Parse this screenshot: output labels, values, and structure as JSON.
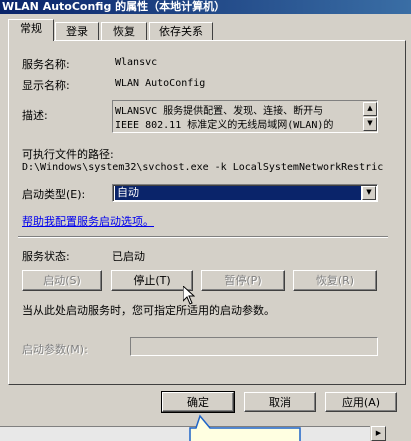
{
  "window": {
    "title": "WLAN AutoConfig 的属性（本地计算机）"
  },
  "tabs": [
    "常规",
    "登录",
    "恢复",
    "依存关系"
  ],
  "general": {
    "service_name_label": "服务名称:",
    "service_name_value": "Wlansvc",
    "display_name_label": "显示名称:",
    "display_name_value": "WLAN AutoConfig",
    "description_label": "描述:",
    "description_line1": "WLANSVC 服务提供配置、发现、连接、断开与",
    "description_line2": "IEEE 802.11 标准定义的无线局域网(WLAN)的",
    "exe_path_label": "可执行文件的路径:",
    "exe_path_value": "D:\\Windows\\system32\\svchost.exe -k LocalSystemNetworkRestric",
    "startup_type_label": "启动类型(E):",
    "startup_type_value": "自动",
    "help_link": "帮助我配置服务启动选项。",
    "service_status_label": "服务状态:",
    "service_status_value": "已启动",
    "start_button": "启动(S)",
    "stop_button": "停止(T)",
    "pause_button": "暂停(P)",
    "resume_button": "恢复(R)",
    "start_hint": "当从此处启动服务时，您可指定所适用的启动参数。",
    "start_params_label": "启动参数(M):",
    "start_params_value": ""
  },
  "footer": {
    "ok_button": "确定",
    "cancel_button": "取消",
    "apply_button": "应用(A)"
  },
  "colors": {
    "selection": "#0a246a",
    "link": "#0000ee",
    "face": "#d4d0c8"
  }
}
